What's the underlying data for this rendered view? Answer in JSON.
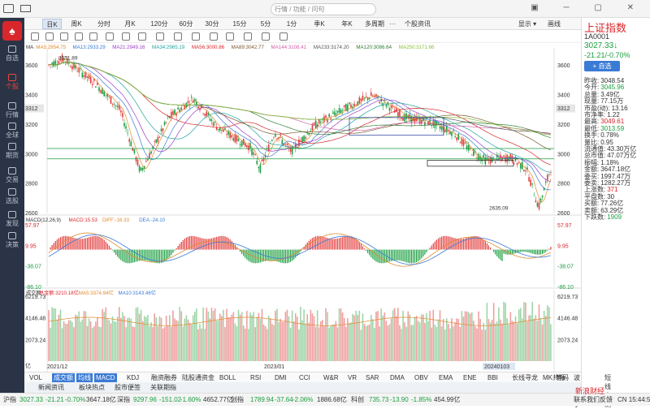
{
  "search": {
    "placeholder": "行情 / 功能 / 问句"
  },
  "sidebar": {
    "items": [
      {
        "label": "自选"
      },
      {
        "label": "个股"
      },
      {
        "label": "行情"
      },
      {
        "label": "全球"
      },
      {
        "label": "期货"
      },
      {
        "label": "交易"
      },
      {
        "label": "选股"
      },
      {
        "label": "发现"
      },
      {
        "label": "决策"
      }
    ]
  },
  "tabs": [
    {
      "label": "日K"
    },
    {
      "label": "周K"
    },
    {
      "label": "分时"
    },
    {
      "label": "月K"
    },
    {
      "label": "120分"
    },
    {
      "label": "60分"
    },
    {
      "label": "30分"
    },
    {
      "label": "15分"
    },
    {
      "label": "5分"
    },
    {
      "label": "1分"
    },
    {
      "label": "季K"
    },
    {
      "label": "年K"
    },
    {
      "label": "多周期"
    },
    {
      "label": "···"
    },
    {
      "label": "个股资讯"
    },
    {
      "label": "显示 ▾"
    },
    {
      "label": "画线"
    }
  ],
  "ma_legend": [
    {
      "label": "MA",
      "color": "#333333"
    },
    {
      "label": "MA5:2954.75",
      "color": "#e08a2c"
    },
    {
      "label": "MA13:2933.29",
      "color": "#3a7bd5"
    },
    {
      "label": "MA21:2949.16",
      "color": "#9b3fc4"
    },
    {
      "label": "MA34:2965.19",
      "color": "#1fa6a0"
    },
    {
      "label": "MA56:3000.86",
      "color": "#d9262b"
    },
    {
      "label": "MA89:3042.77",
      "color": "#7a5a2a"
    },
    {
      "label": "MA144:3108.41",
      "color": "#d35ea8"
    },
    {
      "label": "MA233:3174.20",
      "color": "#555555"
    },
    {
      "label": "MA120:3086.64",
      "color": "#2e7d32"
    },
    {
      "label": "MA250:3171.66",
      "color": "#8bbf3a"
    }
  ],
  "price_axis": {
    "left": [
      "3600",
      "3400",
      "3200",
      "3000",
      "2800",
      "2600"
    ],
    "right": [
      "3600",
      "3400",
      "3200",
      "3000",
      "2800",
      "2600"
    ],
    "highlight": "3312",
    "high_label": "3651.89",
    "low_label": "2635.09"
  },
  "macd": {
    "legend": [
      {
        "label": "MACD(12,26,9)",
        "color": "#333333"
      },
      {
        "label": "MACD:15.53",
        "color": "#d9262b"
      },
      {
        "label": "DIFF:-16.33",
        "color": "#e08a2c"
      },
      {
        "label": "DEA:-24.10",
        "color": "#3a7bd5"
      }
    ],
    "ticks": [
      "57.97",
      "9.95",
      "-38.07",
      "-86.10"
    ]
  },
  "volume": {
    "legend": [
      {
        "label": "成交额",
        "color": "#333333"
      },
      {
        "label": "总金额:3210.18亿",
        "color": "#d9262b"
      },
      {
        "label": "MA5:3374.94亿",
        "color": "#e08a2c"
      },
      {
        "label": "MA10:3143.46亿",
        "color": "#3a7bd5"
      }
    ],
    "ticks": [
      "6219.73",
      "4146.48",
      "2073.24"
    ],
    "unit": "亿"
  },
  "x_axis": {
    "labels": [
      "2021/12",
      "2023/01",
      "20240103"
    ]
  },
  "bottom_tabs": [
    "VOL",
    "成交额",
    "均线",
    "MACD",
    "KDJ",
    "融资融券",
    "陆股通资金",
    "BOLL",
    "RSI",
    "DMI",
    "CCI",
    "W&R",
    "VR",
    "SAR",
    "DMA",
    "OBV",
    "EMA",
    "ENE",
    "BBI",
    "长线寻龙",
    "MK共振",
    "波段助手",
    "短线窥测",
    "筹码"
  ],
  "news_tabs": [
    "新闻资讯",
    "板块热点",
    "股市便签",
    "关联期指"
  ],
  "right_panel": {
    "name": "上证指数",
    "code": "1A0001",
    "price": "3027.33↓",
    "change": "-21.21/-0.70%",
    "add_label": "+ 自选",
    "rows": [
      {
        "k": "昨收:",
        "v": "3048.54",
        "c": "#333333"
      },
      {
        "k": "今开:",
        "v": "3045.96",
        "c": "#1a9e3f"
      },
      {
        "k": "总量:",
        "v": "3.49亿",
        "c": "#333333"
      },
      {
        "k": "现量:",
        "v": "77.15万",
        "c": "#333333"
      },
      {
        "k": "市盈(动):",
        "v": "13.16",
        "c": "#333333"
      },
      {
        "k": "市净率:",
        "v": "1.22",
        "c": "#333333"
      },
      {
        "k": "最高:",
        "v": "3049.61",
        "c": "#d9262b"
      },
      {
        "k": "最低:",
        "v": "3013.59",
        "c": "#1a9e3f"
      },
      {
        "k": "换手:",
        "v": "0.78%",
        "c": "#333333"
      },
      {
        "k": "量比:",
        "v": "0.95",
        "c": "#333333"
      },
      {
        "k": "流通值:",
        "v": "43.30万亿",
        "c": "#333333"
      },
      {
        "k": "总市值:",
        "v": "47.07万亿",
        "c": "#333333"
      },
      {
        "k": "振幅:",
        "v": "1.18%",
        "c": "#333333"
      },
      {
        "k": "金额:",
        "v": "3647.18亿",
        "c": "#333333"
      },
      {
        "k": "委买:",
        "v": "1997.47万",
        "c": "#333333"
      },
      {
        "k": "委卖:",
        "v": "1282.27万",
        "c": "#333333"
      },
      {
        "k": "上涨数:",
        "v": "371",
        "c": "#d9262b"
      },
      {
        "k": "平盘数:",
        "v": "30",
        "c": "#333333"
      },
      {
        "k": "买额:",
        "v": "77.26亿",
        "c": "#333333"
      },
      {
        "k": "卖额:",
        "v": "63.29亿",
        "c": "#333333"
      },
      {
        "k": "下跌数:",
        "v": "1909",
        "c": "#1a9e3f"
      }
    ]
  },
  "ticker": [
    {
      "t": "沪指",
      "c": "#333333"
    },
    {
      "t": "3027.33",
      "c": "#1a9e3f"
    },
    {
      "t": "-21.21",
      "c": "#1a9e3f"
    },
    {
      "t": "-0.70%",
      "c": "#1a9e3f"
    },
    {
      "t": "3647.18亿",
      "c": "#333333"
    },
    {
      "t": "深指",
      "c": "#333333"
    },
    {
      "t": "9297.96",
      "c": "#1a9e3f"
    },
    {
      "t": "-151.02",
      "c": "#1a9e3f"
    },
    {
      "t": "-1.60%",
      "c": "#1a9e3f"
    },
    {
      "t": "4652.77亿",
      "c": "#333333"
    },
    {
      "t": "创指",
      "c": "#333333"
    },
    {
      "t": "1789.94",
      "c": "#1a9e3f"
    },
    {
      "t": "-37.64",
      "c": "#1a9e3f"
    },
    {
      "t": "-2.06%",
      "c": "#1a9e3f"
    },
    {
      "t": "1886.68亿",
      "c": "#333333"
    },
    {
      "t": "科创",
      "c": "#333333"
    },
    {
      "t": "735.73",
      "c": "#1a9e3f"
    },
    {
      "t": "-13.90",
      "c": "#1a9e3f"
    },
    {
      "t": "-1.85%",
      "c": "#1a9e3f"
    },
    {
      "t": "454.99亿",
      "c": "#333333"
    },
    {
      "t": "联系我们",
      "c": "#333333"
    },
    {
      "t": "反馈",
      "c": "#333333"
    },
    {
      "t": "CN 15:44:50",
      "c": "#333333"
    }
  ],
  "watermark": "新浪财经"
}
